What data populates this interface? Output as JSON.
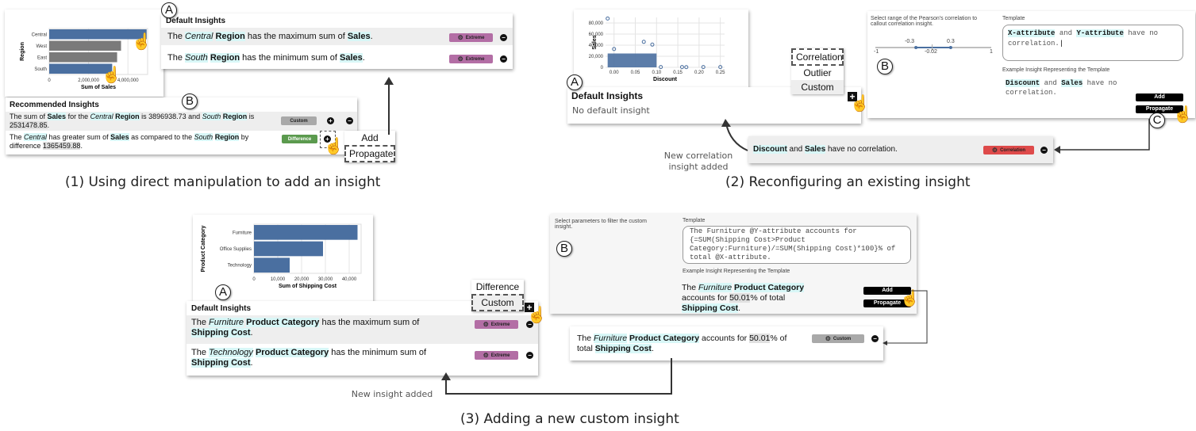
{
  "panel1": {
    "caption": "(1) Using direct manipulation to add an insight",
    "chart_data": {
      "type": "bar",
      "orientation": "horizontal",
      "categories": [
        "Central",
        "West",
        "East",
        "South"
      ],
      "values": [
        4950000,
        3650000,
        3450000,
        3200000
      ],
      "highlighted": [
        "Central",
        "South"
      ],
      "xlabel": "Sum of Sales",
      "ylabel": "Region",
      "xticks": [
        "0",
        "2,000,000",
        "4,000,000"
      ],
      "xlim": [
        0,
        5000000
      ]
    },
    "default_insights": {
      "marker": "A",
      "title": "Default Insights",
      "rows": [
        {
          "pre": "The ",
          "cat": "Central",
          "mid1": " ",
          "dim": "Region",
          "mid2": " has the maximum sum of ",
          "meas": "Sales",
          "post": ".",
          "badge": "Extreme"
        },
        {
          "pre": "The ",
          "cat": "South",
          "mid1": " ",
          "dim": "Region",
          "mid2": " has the minimum sum of ",
          "meas": "Sales",
          "post": ".",
          "badge": "Extreme"
        }
      ]
    },
    "recommended_insights": {
      "marker": "B",
      "title": "Recommended Insights",
      "row1": {
        "t1": "The sum of ",
        "m1": "Sales",
        "t2": " for the ",
        "c1": "Central",
        "t3": " ",
        "d1": "Region",
        "t4": " is 3896938.73 and ",
        "c2": "South",
        "t5": " ",
        "d2": "Region",
        "t6": " is ",
        "n1": "2531478.85",
        "t7": ".",
        "badge": "Custom"
      },
      "row2": {
        "t1": "The ",
        "c1": "Central",
        "t2": " has greater sum of ",
        "m1": "Sales",
        "t3": " as compared to the ",
        "c2": "South",
        "t4": " ",
        "d1": "Region",
        "t5": " by difference ",
        "n1": "1365459.88",
        "t6": ".",
        "badge": "Difference"
      }
    },
    "menu": [
      "Add",
      "Propagate"
    ]
  },
  "panel2": {
    "caption": "(2) Reconfiguring an existing insight",
    "chart_data": {
      "type": "scatter",
      "xlabel": "Discount",
      "ylabel": "Sales",
      "xticks": [
        "0.00",
        "0.05",
        "0.10",
        "0.15",
        "0.20",
        "0.25"
      ],
      "yticks": [
        "0",
        "20,000",
        "40,000",
        "60,000",
        "80,000"
      ],
      "xlim": [
        -0.02,
        0.26
      ],
      "ylim": [
        0,
        90000
      ],
      "outliers": [
        [
          -0.015,
          88000
        ],
        [
          0.0,
          33000
        ],
        [
          0.07,
          46000
        ],
        [
          0.09,
          41000
        ],
        [
          0.11,
          500
        ],
        [
          0.16,
          500
        ],
        [
          0.17,
          300
        ],
        [
          0.21,
          500
        ],
        [
          0.25,
          500
        ]
      ]
    },
    "default_insights": {
      "marker": "A",
      "title": "Default Insights",
      "empty": "No default insight"
    },
    "menu": [
      "Correlation",
      "Outlier",
      "Custom"
    ],
    "config": {
      "marker_b": "B",
      "marker_c": "C",
      "range_label": "Select range of the Pearson's correlation to callout correlation insight.",
      "slider": {
        "min": "-1",
        "max": "1",
        "low": "-0.3",
        "high": "0.3",
        "value": "-0.02",
        "low_value": -0.3,
        "high_value": 0.3,
        "current": -0.02
      },
      "template_label": "Template",
      "template": {
        "x": "X-attribute",
        "and": " and ",
        "y": "Y-attribute",
        "rest": " have no correlation."
      },
      "example_label": "Example Insight Representing the Template",
      "example": {
        "x": "Discount",
        "and": " and ",
        "y": "Sales",
        "rest": " have no correlation."
      },
      "add": "Add",
      "propagate": "Propagate"
    },
    "new_insight": {
      "x": "Discount",
      "and": " and ",
      "y": "Sales",
      "rest": " have no correlation.",
      "badge": "Correlation"
    },
    "note": "New correlation insight added"
  },
  "panel3": {
    "caption": "(3) Adding a new custom insight",
    "chart_data": {
      "type": "bar",
      "orientation": "horizontal",
      "categories": [
        "Furniture",
        "Office Supplies",
        "Technology"
      ],
      "values": [
        43500,
        29000,
        15000
      ],
      "xlabel": "Sum of Shipping Cost",
      "ylabel": "Product Category",
      "xticks": [
        "0",
        "10,000",
        "20,000",
        "30,000",
        "40,000"
      ],
      "xlim": [
        0,
        45000
      ]
    },
    "default_insights": {
      "marker": "A",
      "title": "Default Insights",
      "rows": [
        {
          "pre": "The ",
          "cat": "Furniture",
          "mid1": " ",
          "dim": "Product Category",
          "mid2": " has the maximum sum of ",
          "meas": "Shipping Cost",
          "post": ".",
          "badge": "Extreme"
        },
        {
          "pre": "The ",
          "cat": "Technology",
          "mid1": " ",
          "dim": "Product Category",
          "mid2": " has the minimum sum of ",
          "meas": "Shipping Cost",
          "post": ".",
          "badge": "Extreme"
        }
      ]
    },
    "menu": [
      "Difference",
      "Custom"
    ],
    "config": {
      "marker_b": "B",
      "filter_label": "Select parameters to filter the custom insight.",
      "template_label": "Template",
      "template": "The Furniture @Y-attribute accounts for {=SUM(Shipping Cost>Product Category:Furniture)/=SUM(Shipping Cost)*100}% of total @X-attribute.",
      "example_label": "Example Insight Representing the Template",
      "example": {
        "t1": "The ",
        "c": "Furniture",
        "t2": " ",
        "d": "Product Category",
        "t3": " accounts for ",
        "n": "50.01",
        "t4": "% of total ",
        "m": "Shipping Cost",
        "t5": "."
      },
      "add": "Add",
      "propagate": "Propagate"
    },
    "new_insight": {
      "t1": "The ",
      "c": "Furniture",
      "t2": " ",
      "d": "Product Category",
      "t3": " accounts for ",
      "n": "50.01",
      "t4": "% of total ",
      "m": "Shipping Cost",
      "t5": ".",
      "badge": "Custom"
    },
    "note": "New insight added"
  },
  "colors": {
    "bar_blue": "#4a6fa0",
    "bar_gray": "#7a7a7a",
    "extreme": "#b36ea5",
    "custom": "#a9a9a9",
    "difference": "#5b9a4e",
    "correlation": "#de4a4a",
    "highlight": "#d8f7f7"
  }
}
